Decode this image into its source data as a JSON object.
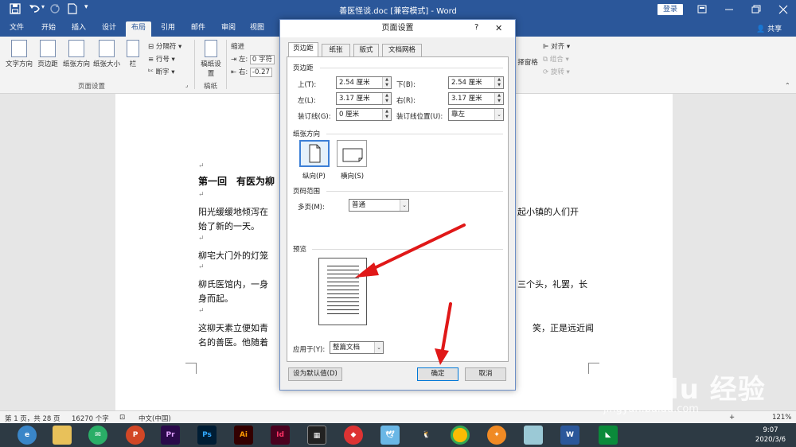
{
  "titlebar": {
    "title": "善医怪谈.doc [兼容模式] - Word",
    "login": "登录",
    "quick_access": [
      "save-icon",
      "undo-icon",
      "redo-icon",
      "new-doc-icon",
      "customize-icon"
    ]
  },
  "tabs": [
    {
      "label": "文件"
    },
    {
      "label": "开始"
    },
    {
      "label": "插入"
    },
    {
      "label": "设计"
    },
    {
      "label": "布局"
    },
    {
      "label": "引用"
    },
    {
      "label": "邮件"
    },
    {
      "label": "审阅"
    },
    {
      "label": "视图"
    }
  ],
  "active_tab": "布局",
  "share": "共享",
  "ribbon": {
    "text_direction": "文字方向",
    "margins": "页边距",
    "orientation": "纸张方向",
    "size": "纸张大小",
    "columns": "栏",
    "breaks": "分隔符",
    "line_numbers": "行号",
    "hyphenation": "断字",
    "page_setup_group": "页面设置",
    "manuscript": "稿纸设置",
    "manuscript_group": "稿纸",
    "indent": "缩进",
    "indent_left": "左:",
    "indent_left_val": "0 字符",
    "indent_right": "右:",
    "indent_right_val": "-0.27",
    "selection_pane": "择窗格",
    "align": "对齐",
    "group": "组合",
    "rotate": "旋转"
  },
  "document": {
    "heading": "第一回　有医为柳",
    "p1a": "阳光缓缓地倾泻在",
    "p1a_right": "起小镇的人们开",
    "p1b": "始了新的一天。",
    "p2": "柳宅大门外的灯笼",
    "p3a": "柳氏医馆内，一身",
    "p3a_right": "三个头，礼罢，长",
    "p3b": "身而起。",
    "p4a": "这柳天素立便如青",
    "p4a_right": "笑，正是远近闻",
    "p4b": "名的善医。他随着",
    "para_mark": "↵"
  },
  "statusbar": {
    "page": "第 1 页，共 28 页",
    "words": "16270 个字",
    "language": "中文(中国)",
    "zoom": "121%"
  },
  "taskbar": {
    "apps": [
      "browser-icon",
      "file-explorer-icon",
      "wechat-icon",
      "powerpoint-icon",
      "premiere-icon",
      "photoshop-icon",
      "illustrator-icon",
      "indesign-icon",
      "video-editor-icon",
      "media-icon",
      "bird-icon",
      "qq-icon",
      "chrome-icon",
      "orange-app-icon",
      "cube-icon",
      "word-icon",
      "green-app-icon"
    ],
    "time": "9:07",
    "date": "2020/3/6"
  },
  "dialog": {
    "title": "页面设置",
    "help": "?",
    "tabs": [
      "页边距",
      "纸张",
      "版式",
      "文档网格"
    ],
    "margins_section": "页边距",
    "top_label": "上(T):",
    "top_value": "2.54 厘米",
    "bottom_label": "下(B):",
    "bottom_value": "2.54 厘米",
    "left_label": "左(L):",
    "left_value": "3.17 厘米",
    "right_label": "右(R):",
    "right_value": "3.17 厘米",
    "gutter_label": "装订线(G):",
    "gutter_value": "0 厘米",
    "gutter_pos_label": "装订线位置(U):",
    "gutter_pos_value": "靠左",
    "orientation_section": "纸张方向",
    "portrait": "纵向(P)",
    "landscape": "横向(S)",
    "pages_section": "页码范围",
    "multiple_pages_label": "多页(M):",
    "multiple_pages_value": "普通",
    "preview_section": "预览",
    "apply_to_label": "应用于(Y):",
    "apply_to_value": "整篇文档",
    "default_button": "设为默认值(D)",
    "ok_button": "确定",
    "cancel_button": "取消"
  },
  "annotation_color": "#e01818",
  "watermark": "Bai du 经验",
  "watermark_url": "jingyan.baidu.com",
  "colors": {
    "word_blue": "#2b579a",
    "ribbon": "#f3f3f3",
    "dialog_bg": "#f0f0f0",
    "accent": "#0078d7"
  }
}
